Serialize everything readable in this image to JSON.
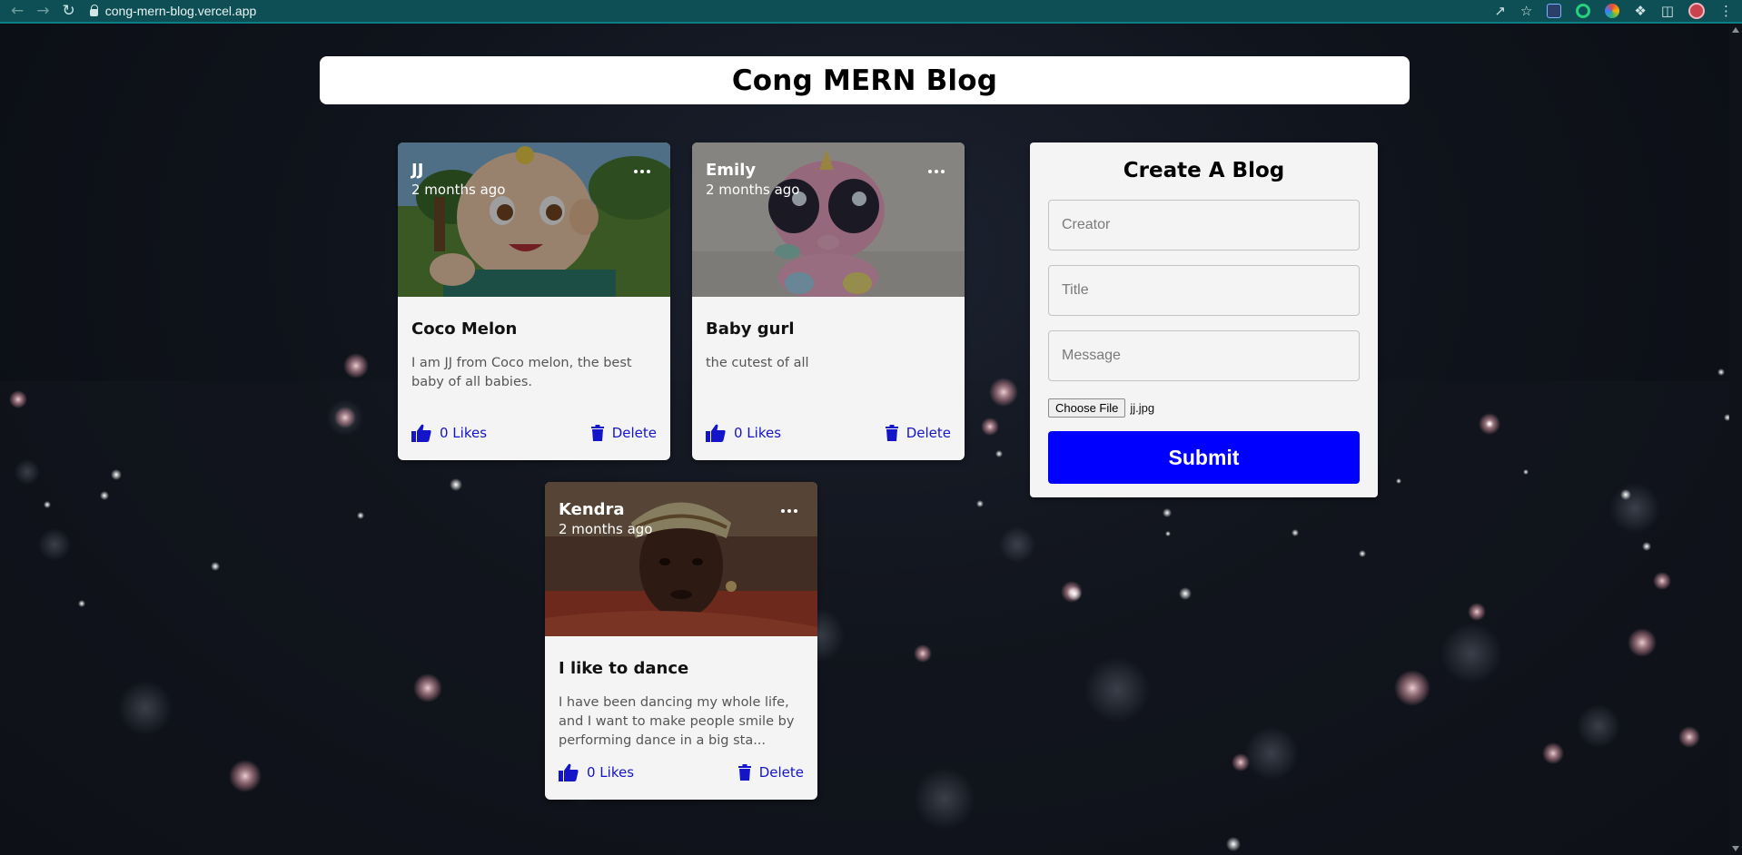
{
  "browser": {
    "url": "cong-mern-blog.vercel.app"
  },
  "app": {
    "title": "Cong MERN Blog"
  },
  "posts": [
    {
      "creator": "JJ",
      "time": "2 months ago",
      "title": "Coco Melon",
      "message": "I am JJ from Coco melon, the best baby of all babies.",
      "likes": "0 Likes",
      "delete": "Delete"
    },
    {
      "creator": "Emily",
      "time": "2 months ago",
      "title": "Baby gurl",
      "message": "the cutest of all",
      "likes": "0 Likes",
      "delete": "Delete"
    },
    {
      "creator": "Kendra",
      "time": "2 months ago",
      "title": "I like to dance",
      "message": "I have been dancing my whole life, and I want to make people smile by performing dance in a big sta...",
      "likes": "0 Likes",
      "delete": "Delete"
    }
  ],
  "form": {
    "heading": "Create A Blog",
    "creator_placeholder": "Creator",
    "title_placeholder": "Title",
    "message_placeholder": "Message",
    "file_button": "Choose File",
    "file_name": "jj.jpg",
    "submit": "Submit"
  },
  "colors": {
    "accent": "#0000ff",
    "chrome": "#0e4f55",
    "card": "#f4f4f4"
  }
}
